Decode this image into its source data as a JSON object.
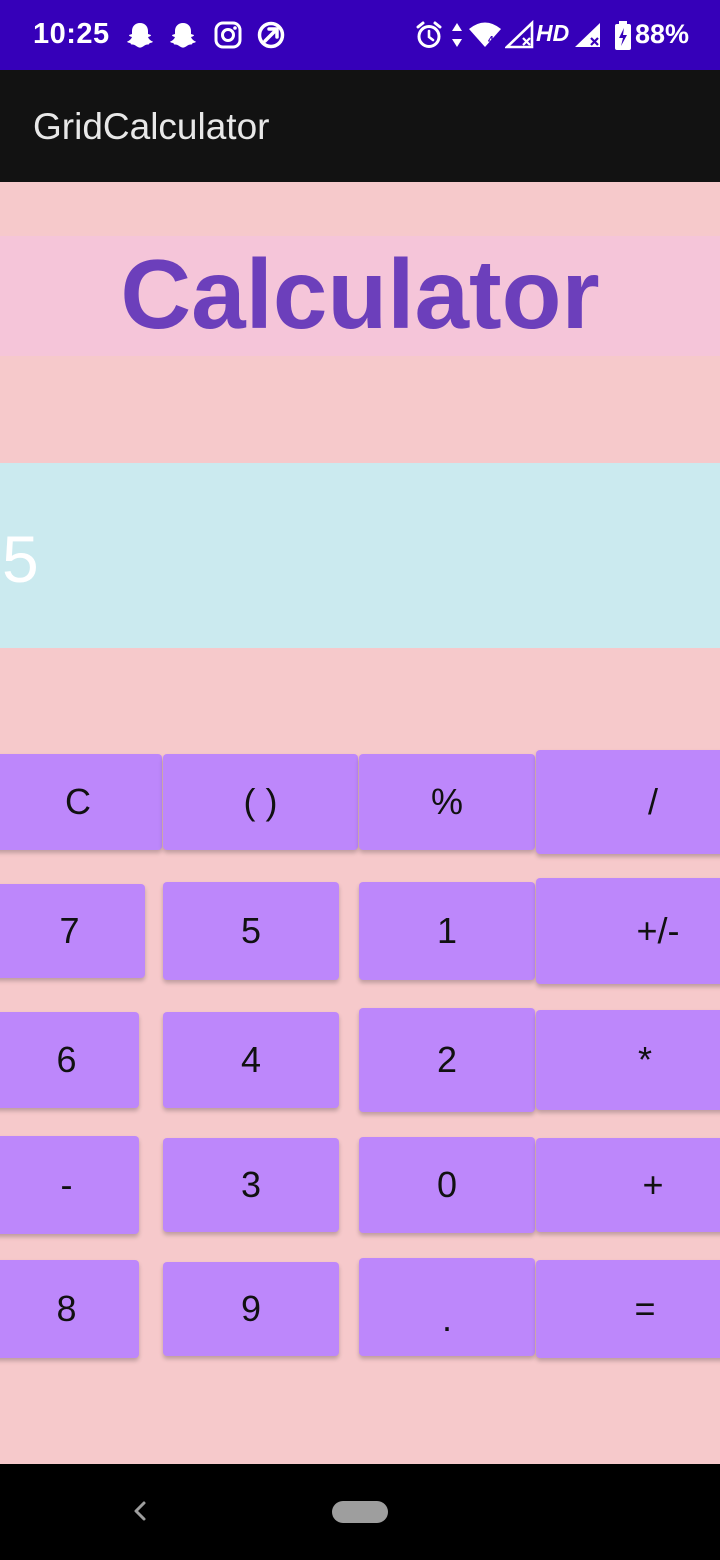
{
  "status_bar": {
    "time": "10:25",
    "battery": "88%",
    "network_label": "HD",
    "icons": [
      "snapchat-icon",
      "snapchat-icon",
      "instagram-icon",
      "data-saver-icon",
      "alarm-icon",
      "data-arrows-icon",
      "wifi-icon",
      "signal-icon",
      "signal-icon",
      "battery-charging-icon"
    ]
  },
  "app_bar": {
    "title": "GridCalculator"
  },
  "heading": {
    "text": "Calculator"
  },
  "display": {
    "value": "5"
  },
  "keys": [
    "C",
    "( )",
    "%",
    "/",
    "7",
    "5",
    "1",
    "+/-",
    "6",
    "4",
    "2",
    "*",
    "-",
    "3",
    "0",
    "+",
    "8",
    "9",
    ".",
    "="
  ],
  "colors": {
    "status_bar": "#3600b9",
    "app_bar": "#121212",
    "background": "#f6c9cb",
    "title_band": "#f5c5d9",
    "title_text": "#6c3fbb",
    "display": "#cbeaef",
    "key": "#bd87fb"
  }
}
